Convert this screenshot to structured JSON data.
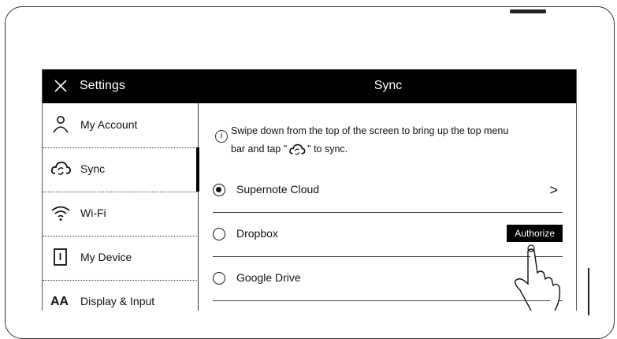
{
  "header": {
    "left_title": "Settings",
    "right_title": "Sync"
  },
  "sidebar": {
    "items": [
      {
        "label": "My Account",
        "icon": "person-icon"
      },
      {
        "label": "Sync",
        "icon": "cloud-sync-icon"
      },
      {
        "label": "Wi-Fi",
        "icon": "wifi-icon"
      },
      {
        "label": "My Device",
        "icon": "device-icon"
      },
      {
        "label": "Display & Input",
        "icon": "font-size-icon"
      }
    ],
    "active_index": 1
  },
  "sync": {
    "info_line1": "Swipe down from the top of the screen to bring up the top menu",
    "info_line2_prefix": "bar and tap \"",
    "info_line2_suffix": "\" to sync.",
    "options": [
      {
        "label": "Supernote Cloud",
        "selected": true,
        "action": ">"
      },
      {
        "label": "Dropbox",
        "selected": false,
        "action": "Authorize"
      },
      {
        "label": "Google Drive",
        "selected": false
      }
    ]
  }
}
